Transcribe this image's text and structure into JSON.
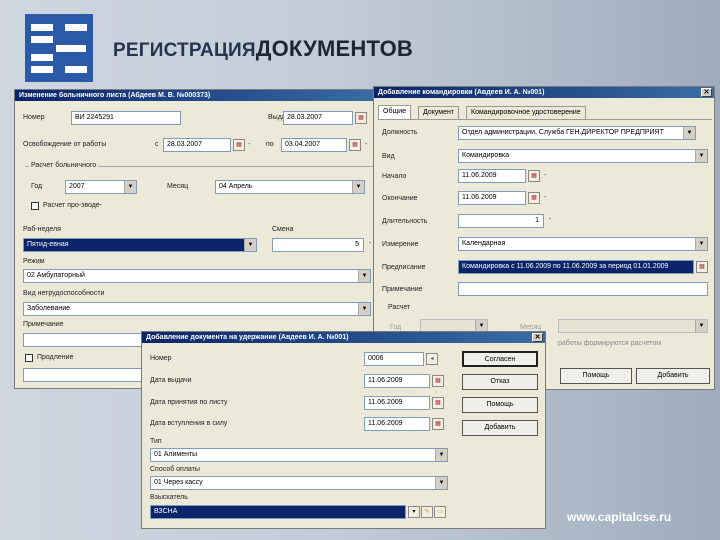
{
  "slide_title_part1": "РЕГИСТРАЦИЯ",
  "slide_title_part2": "ДОКУМЕНТОВ",
  "footer_url": "www.capitalcse.ru",
  "win1": {
    "title": "Изменение больничного листа (Абдеев М. В. №000373)",
    "number_label": "Номер",
    "number_value": "ВИ 2245291",
    "issued_label": "Выда-",
    "issued_value": "28.03.2007",
    "release_label": "Освобождение от работы",
    "from_label": "с",
    "from_value": "28.03.2007",
    "to_label": "по",
    "to_value": "03.04.2007",
    "calc_group_label": "Расчет больничного",
    "year_label": "Год",
    "year_value": "2007",
    "month_label": "Месяц",
    "month_value": "04 Апрель",
    "calc_checkbox_label": "Расчет про-зводе-",
    "workweek_label": "Раб-неделя",
    "workweek_value": "Пятид-евная",
    "shift_label": "Смена",
    "shift_value": "5",
    "mode_label": "Режим",
    "mode_value": "02 Амбулаторный",
    "disability_label": "Вид нетрудоспособности",
    "disability_value": "Заболевание",
    "note_label": "Примечание",
    "extension_label": "Продление"
  },
  "win2": {
    "title": "Добавление командировки (Авдеев И. А. №001)",
    "tabs": [
      "Общие",
      "Документ",
      "Командировочное удостоверение"
    ],
    "position_label": "Должность",
    "position_value": "Отдел администрации, Служба ГЕН.ДИРЕКТОР ПРЕДПРИЯТ",
    "type_label": "Вид",
    "type_value": "Командировка",
    "start_label": "Начало",
    "start_value": "11.06.2009",
    "end_label": "Окончание",
    "end_value": "11.06.2009",
    "duration_label": "Длительность",
    "duration_value": "1",
    "unit_label": "Измерение",
    "unit_value": "Календарная",
    "order_label": "Предписание",
    "order_value": "Командировка с 11.06.2009 по 11.06.2009 за период 01.01.2009",
    "note_label": "Примечание",
    "calc_label": "Расчет",
    "year_label": "Год",
    "month_label": "Месяц",
    "calc_hint": "работы формируются расчетом",
    "btn_help": "Помощь",
    "btn_add": "Добавить"
  },
  "win3": {
    "title": "Добавление документа на удержание (Авдеев И. А. №001)",
    "number_label": "Номер",
    "number_value": "0006",
    "issue_date_label": "Дата выдачи",
    "issue_date_value": "11.06.2009",
    "accept_date_label": "Дата принятия по листу",
    "accept_date_value": "11.06.2009",
    "effective_date_label": "Дата вступления в силу",
    "effective_date_value": "11.06.2009",
    "type_label": "Тип",
    "type_value": "01 Алименты",
    "payment_label": "Способ оплаты",
    "payment_value": "01 Через кассу",
    "recipient_label": "Взыскатель",
    "recipient_value": "ВЗСНА",
    "btn_ok": "Согласен",
    "btn_cancel": "Отказ",
    "btn_help": "Помощь",
    "btn_add": "Добавить"
  }
}
